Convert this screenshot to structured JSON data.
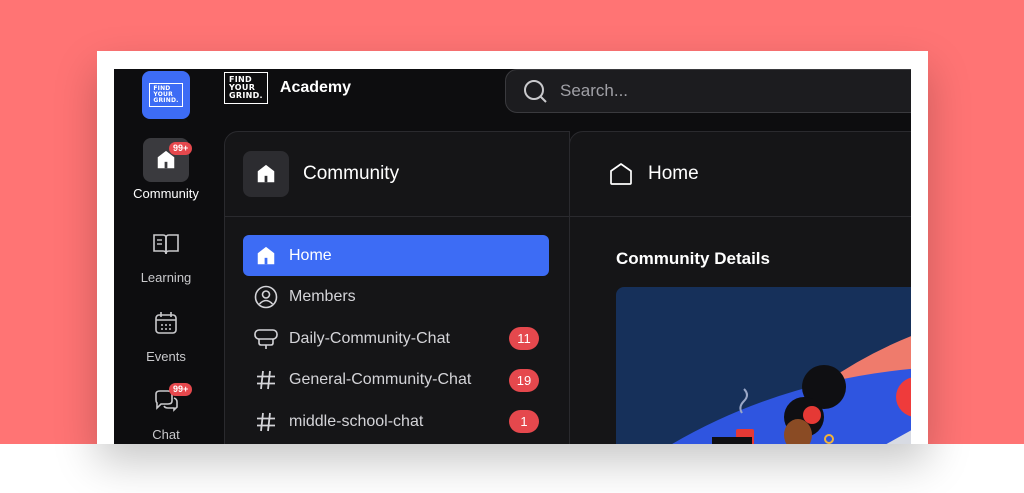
{
  "rail": {
    "logo_lines": [
      "FIND",
      "YOUR",
      "GRIND."
    ],
    "items": [
      {
        "label": "Community",
        "badge": "99+",
        "icon": "home-icon"
      },
      {
        "label": "Learning",
        "icon": "book-icon"
      },
      {
        "label": "Events",
        "icon": "calendar-icon"
      },
      {
        "label": "Chat",
        "badge": "99+",
        "icon": "chat-icon"
      }
    ]
  },
  "header": {
    "brand_logo_lines": [
      "FIND",
      "YOUR",
      "GRIND."
    ],
    "brand_name": "Academy",
    "search_placeholder": "Search..."
  },
  "community_panel": {
    "title": "Community",
    "channels": [
      {
        "label": "Home",
        "icon": "home-icon",
        "active": true
      },
      {
        "label": "Members",
        "icon": "user-circle-icon"
      },
      {
        "label": "Daily-Community-Chat",
        "icon": "monitor-icon",
        "count": "11"
      },
      {
        "label": "General-Community-Chat",
        "icon": "hash-icon",
        "count": "19"
      },
      {
        "label": "middle-school-chat",
        "icon": "hash-icon",
        "count": "1"
      }
    ]
  },
  "home_panel": {
    "title": "Home",
    "section_title": "Community Details"
  },
  "colors": {
    "accent": "#3d6cf5",
    "badge": "#e5484d",
    "background_outer": "#ff7474",
    "app_bg": "#0d0d0f"
  }
}
